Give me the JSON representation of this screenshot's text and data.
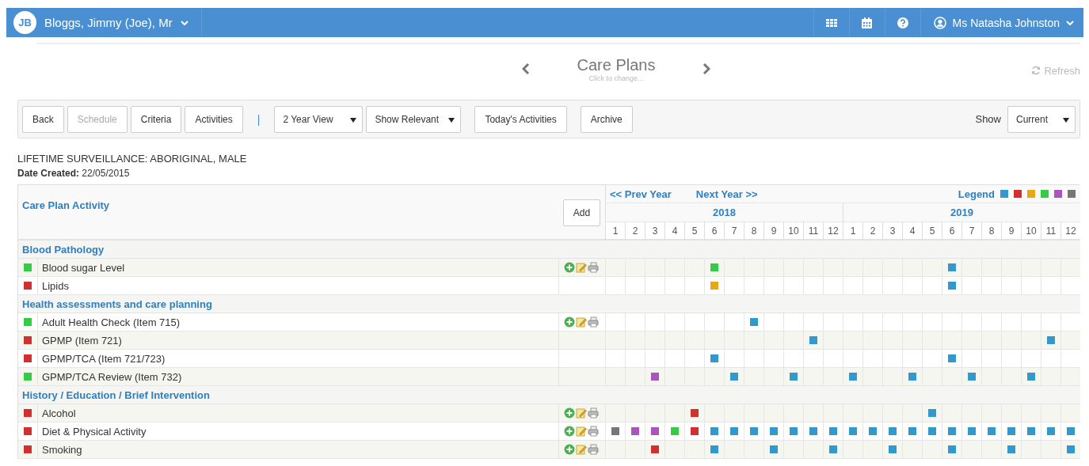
{
  "header": {
    "initials": "JB",
    "patient": "Bloggs, Jimmy (Joe), Mr",
    "user": "Ms Natasha Johnston"
  },
  "title": {
    "text": "Care Plans",
    "hint": "Click to change..."
  },
  "refresh": "Refresh",
  "toolbar": {
    "buttons": [
      {
        "label": "Back",
        "disabled": false
      },
      {
        "label": "Schedule",
        "disabled": true
      },
      {
        "label": "Criteria",
        "disabled": false
      },
      {
        "label": "Activities",
        "disabled": false
      }
    ],
    "separator": "|",
    "selects": [
      "2 Year View",
      "Show Relevant"
    ],
    "today": "Today's Activities",
    "archive": "Archive",
    "show_label": "Show",
    "show_value": "Current"
  },
  "plan": {
    "name": "LIFETIME SURVEILLANCE: ABORIGINAL, MALE",
    "created": "**Date Created:** 22/05/2015"
  },
  "table": {
    "heading": "Care Plan Activity",
    "add": "Add",
    "prev": "<< Prev Year",
    "next": "Next Year >>",
    "legend": "Legend",
    "legend_colors": [
      {
        "color": "#3399cc"
      },
      {
        "color": "#d03030"
      },
      {
        "color": "#e6a817"
      },
      {
        "color": "#33cc44"
      },
      {
        "color": "#aa55bb"
      },
      {
        "color": "#777777"
      }
    ],
    "years": [
      "2018",
      "2019"
    ],
    "months": [
      "1",
      "2",
      "3",
      "4",
      "5",
      "6",
      "7",
      "8",
      "9",
      "10",
      "11",
      "12",
      "1",
      "2",
      "3",
      "4",
      "5",
      "6",
      "7",
      "8",
      "9",
      "10",
      "11",
      "12"
    ],
    "groups": [
      {
        "name": "Blood Pathology",
        "activities": [
          {
            "name": "Blood sugar Level",
            "color": "#33cc44",
            "actions": true,
            "highlighted": true,
            "cells": [
              {},
              {},
              {},
              {},
              {},
              {
                "color": "#33cc44"
              },
              {},
              {},
              {},
              {},
              {},
              {},
              {},
              {},
              {},
              {},
              {},
              {
                "color": "#3399cc"
              },
              {},
              {},
              {},
              {},
              {},
              {}
            ]
          },
          {
            "name": "Lipids",
            "color": "#d03030",
            "actions": false,
            "highlighted": false,
            "cells": [
              {},
              {},
              {},
              {},
              {},
              {
                "color": "#e6a817"
              },
              {},
              {},
              {},
              {},
              {},
              {},
              {},
              {},
              {},
              {},
              {},
              {
                "color": "#3399cc"
              },
              {},
              {},
              {},
              {},
              {},
              {}
            ]
          }
        ]
      },
      {
        "name": "Health assessments and care planning",
        "activities": [
          {
            "name": "Adult Health Check (Item 715)",
            "color": "#33cc44",
            "actions": true,
            "highlighted": false,
            "cells": [
              {},
              {},
              {},
              {},
              {},
              {},
              {},
              {
                "color": "#3399cc"
              },
              {},
              {},
              {},
              {},
              {},
              {},
              {},
              {},
              {},
              {},
              {},
              {},
              {},
              {},
              {},
              {}
            ]
          },
          {
            "name": "GPMP (Item 721)",
            "color": "#d03030",
            "actions": false,
            "highlighted": true,
            "cells": [
              {},
              {},
              {},
              {},
              {},
              {},
              {},
              {},
              {},
              {},
              {
                "color": "#3399cc"
              },
              {},
              {},
              {},
              {},
              {},
              {},
              {},
              {},
              {},
              {},
              {},
              {
                "color": "#3399cc"
              },
              {}
            ]
          },
          {
            "name": "GPMP/TCA (Item 721/723)",
            "color": "#d03030",
            "actions": false,
            "highlighted": false,
            "cells": [
              {},
              {},
              {},
              {},
              {},
              {
                "color": "#3399cc"
              },
              {},
              {},
              {},
              {},
              {},
              {},
              {},
              {},
              {},
              {},
              {},
              {
                "color": "#3399cc"
              },
              {},
              {},
              {},
              {},
              {},
              {}
            ]
          },
          {
            "name": "GPMP/TCA Review (Item 732)",
            "color": "#33cc44",
            "actions": false,
            "highlighted": true,
            "cells": [
              {},
              {},
              {
                "color": "#aa55bb"
              },
              {},
              {},
              {},
              {
                "color": "#3399cc"
              },
              {},
              {},
              {
                "color": "#3399cc"
              },
              {},
              {},
              {
                "color": "#3399cc"
              },
              {},
              {},
              {
                "color": "#3399cc"
              },
              {},
              {},
              {
                "color": "#3399cc"
              },
              {},
              {},
              {
                "color": "#3399cc"
              },
              {},
              {}
            ]
          }
        ]
      },
      {
        "name": "History / Education / Brief Intervention",
        "activities": [
          {
            "name": "Alcohol",
            "color": "#d03030",
            "actions": true,
            "highlighted": true,
            "cells": [
              {},
              {},
              {},
              {},
              {
                "color": "#d03030"
              },
              {},
              {},
              {},
              {},
              {},
              {},
              {},
              {},
              {},
              {},
              {},
              {
                "color": "#3399cc"
              },
              {},
              {},
              {},
              {},
              {},
              {},
              {}
            ]
          },
          {
            "name": "Diet & Physical Activity",
            "color": "#d03030",
            "actions": true,
            "highlighted": false,
            "cells": [
              {
                "color": "#777777"
              },
              {
                "color": "#aa55bb"
              },
              {
                "color": "#aa55bb"
              },
              {
                "color": "#33cc44"
              },
              {
                "color": "#d03030"
              },
              {
                "color": "#3399cc"
              },
              {
                "color": "#3399cc"
              },
              {
                "color": "#3399cc"
              },
              {
                "color": "#3399cc"
              },
              {
                "color": "#3399cc"
              },
              {
                "color": "#3399cc"
              },
              {
                "color": "#3399cc"
              },
              {
                "color": "#3399cc"
              },
              {
                "color": "#3399cc"
              },
              {
                "color": "#3399cc"
              },
              {
                "color": "#3399cc"
              },
              {
                "color": "#3399cc"
              },
              {
                "color": "#3399cc"
              },
              {
                "color": "#3399cc"
              },
              {
                "color": "#3399cc"
              },
              {
                "color": "#3399cc"
              },
              {
                "color": "#3399cc"
              },
              {
                "color": "#3399cc"
              },
              {
                "color": "#3399cc"
              }
            ]
          },
          {
            "name": "Smoking",
            "color": "#d03030",
            "actions": true,
            "highlighted": true,
            "cells": [
              {},
              {},
              {
                "color": "#d03030"
              },
              {},
              {},
              {
                "color": "#3399cc"
              },
              {},
              {},
              {
                "color": "#3399cc"
              },
              {},
              {},
              {
                "color": "#3399cc"
              },
              {},
              {},
              {
                "color": "#3399cc"
              },
              {},
              {},
              {
                "color": "#3399cc"
              },
              {},
              {},
              {
                "color": "#3399cc"
              },
              {},
              {},
              {
                "color": "#3399cc"
              }
            ]
          }
        ]
      }
    ]
  }
}
